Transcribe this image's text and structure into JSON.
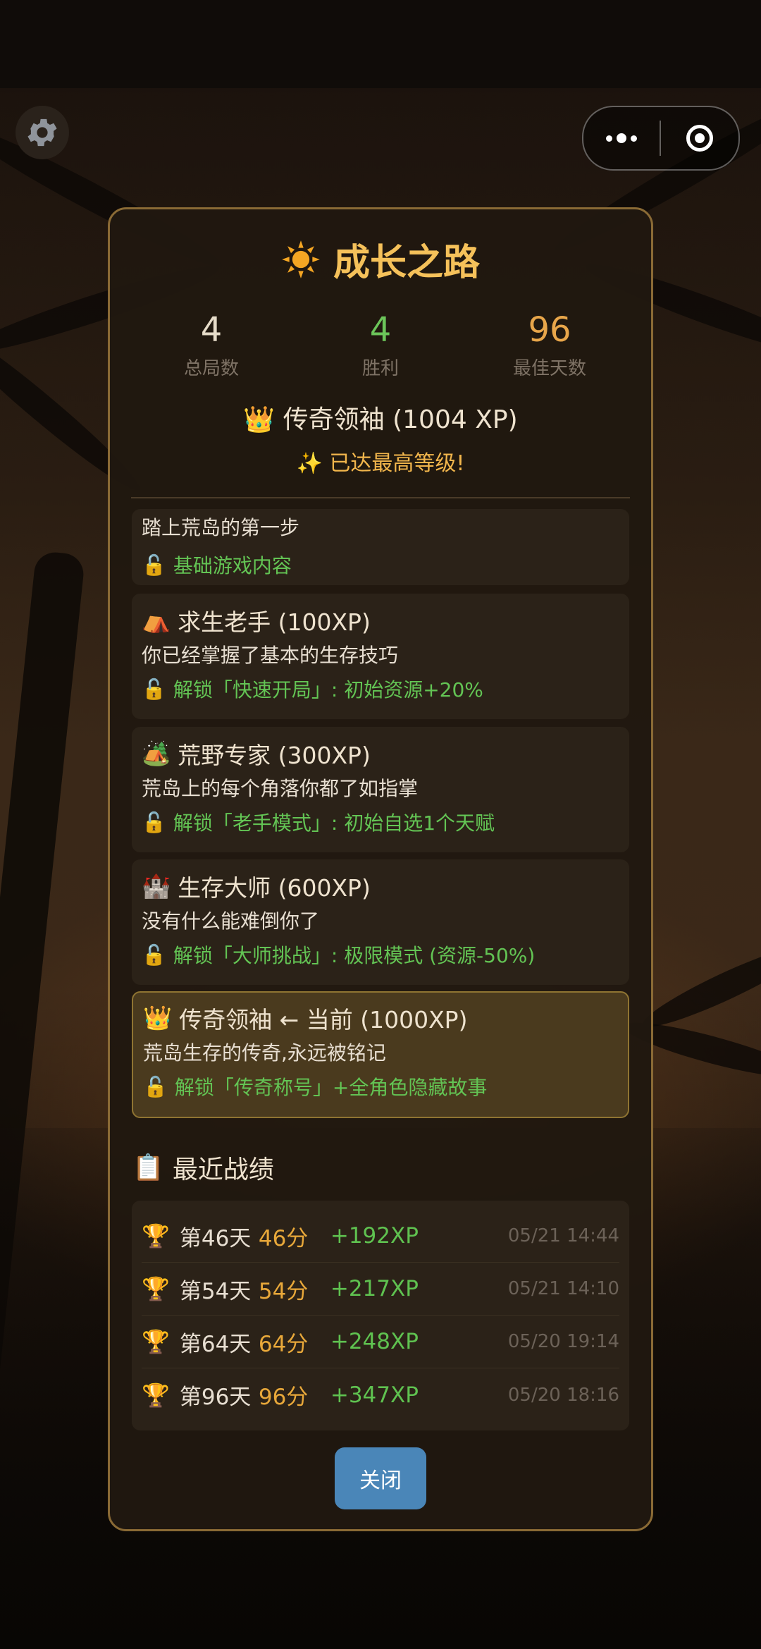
{
  "modal": {
    "title": "成长之路",
    "stats": [
      {
        "value": "4",
        "label": "总局数",
        "color": "#e6dcc9"
      },
      {
        "value": "4",
        "label": "胜利",
        "color": "#6cc55a"
      },
      {
        "value": "96",
        "label": "最佳天数",
        "color": "#e8a64a"
      }
    ],
    "rank": "传奇领袖 (1004 XP)",
    "max_level": "✨ 已达最高等级!",
    "levels": [
      {
        "title": "",
        "desc": "踏上荒岛的第一步",
        "unlock": "基础游戏内容"
      },
      {
        "icon": "⛺",
        "title": "求生老手 (100XP)",
        "desc": "你已经掌握了基本的生存技巧",
        "unlock": "解锁「快速开局」: 初始资源+20%"
      },
      {
        "icon": "🏕️",
        "title": "荒野专家 (300XP)",
        "desc": "荒岛上的每个角落你都了如指掌",
        "unlock": "解锁「老手模式」: 初始自选1个天赋"
      },
      {
        "icon": "🏰",
        "title": "生存大师 (600XP)",
        "desc": "没有什么能难倒你了",
        "unlock": "解锁「大师挑战」: 极限模式 (资源-50%)"
      },
      {
        "icon": "👑",
        "title": "传奇领袖 ← 当前 (1000XP)",
        "desc": "荒岛生存的传奇,永远被铭记",
        "unlock": "解锁「传奇称号」+全角色隐藏故事"
      }
    ],
    "recent_title": "最近战绩",
    "records": [
      {
        "day": "第46天",
        "score": "46分",
        "xp": "+192XP",
        "time": "05/21 14:44"
      },
      {
        "day": "第54天",
        "score": "54分",
        "xp": "+217XP",
        "time": "05/21 14:10"
      },
      {
        "day": "第64天",
        "score": "64分",
        "xp": "+248XP",
        "time": "05/20 19:14"
      },
      {
        "day": "第96天",
        "score": "96分",
        "xp": "+347XP",
        "time": "05/20 18:16"
      }
    ],
    "close_label": "关闭"
  }
}
